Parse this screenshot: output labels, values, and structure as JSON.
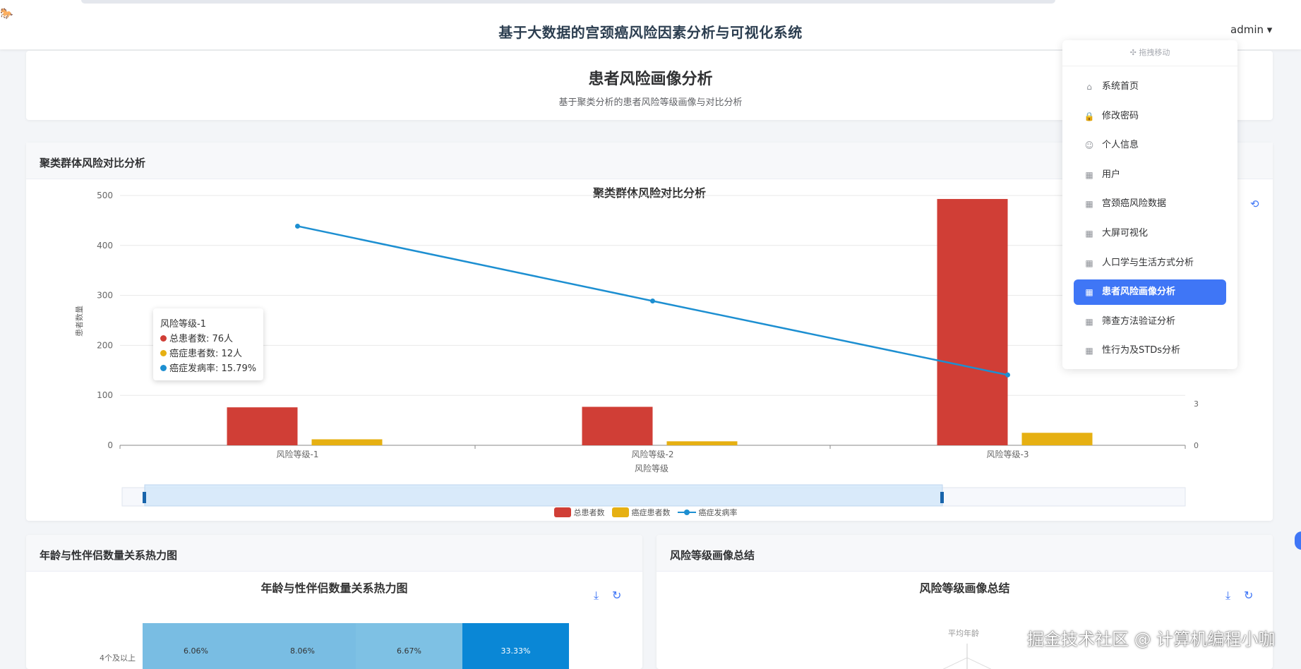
{
  "app": {
    "corner_glyph": "🐎",
    "title": "基于大数据的宫颈癌风险因素分析与可视化系统",
    "user": "admin ▾"
  },
  "page": {
    "title": "患者风险画像分析",
    "subtitle": "基于聚类分析的患者风险等级画像与对比分析"
  },
  "menu": {
    "drag_label": "✣ 拖拽移动",
    "items": [
      {
        "label": "系统首页",
        "icon": "home-icon",
        "glyph": "⌂",
        "active": false
      },
      {
        "label": "修改密码",
        "icon": "lock-icon",
        "glyph": "🔒",
        "active": false
      },
      {
        "label": "个人信息",
        "icon": "user-icon",
        "glyph": "☺",
        "active": false
      },
      {
        "label": "用户",
        "icon": "grid-icon",
        "glyph": "▦",
        "active": false
      },
      {
        "label": "宫颈癌风险数据",
        "icon": "grid-icon",
        "glyph": "▦",
        "active": false
      },
      {
        "label": "大屏可视化",
        "icon": "grid-icon",
        "glyph": "▦",
        "active": false
      },
      {
        "label": "人口学与生活方式分析",
        "icon": "grid-icon",
        "glyph": "▦",
        "active": false
      },
      {
        "label": "患者风险画像分析",
        "icon": "grid-icon",
        "glyph": "▦",
        "active": true
      },
      {
        "label": "筛查方法验证分析",
        "icon": "grid-icon",
        "glyph": "▦",
        "active": false
      },
      {
        "label": "性行为及STDs分析",
        "icon": "grid-icon",
        "glyph": "▦",
        "active": false
      }
    ]
  },
  "panels": {
    "cluster": "聚类群体风险对比分析",
    "heatmap": "年龄与性伴侣数量关系热力图",
    "summary": "风险等级画像总结"
  },
  "chart_data": [
    {
      "type": "bar",
      "title": "聚类群体风险对比分析",
      "xlabel": "风险等级",
      "ylabel": "患者数量",
      "categories": [
        "风险等级-1",
        "风险等级-2",
        "风险等级-3"
      ],
      "ylim": [
        0,
        500
      ],
      "yticks": [
        0,
        100,
        200,
        300,
        400,
        500
      ],
      "y2_ticks_visible": [
        0,
        3
      ],
      "series": [
        {
          "name": "总患者数",
          "type": "bar",
          "color": "#d03e36",
          "values": [
            76,
            77,
            493
          ]
        },
        {
          "name": "癌症患者数",
          "type": "bar",
          "color": "#e6b012",
          "values": [
            12,
            8,
            25
          ]
        },
        {
          "name": "癌症发病率",
          "type": "line",
          "color": "#1d8fd1",
          "values": [
            15.79,
            10.4,
            5.07
          ]
        }
      ],
      "y2lim": [
        0,
        18
      ],
      "legend": "bottom-center",
      "grid": true,
      "tooltip": {
        "title": "风险等级-1",
        "rows": [
          {
            "color": "#d03e36",
            "text": "总患者数: 76人"
          },
          {
            "color": "#e6b012",
            "text": "癌症患者数: 12人"
          },
          {
            "color": "#1d8fd1",
            "text": "癌症发病率: 15.79%"
          }
        ]
      }
    },
    {
      "type": "heatmap",
      "title": "年龄与性伴侣数量关系热力图",
      "y_categories": [
        "4个及以上"
      ],
      "values": [
        [
          "6.06%",
          "8.06%",
          "6.67%",
          "33.33%"
        ]
      ],
      "colors": [
        "#79bde3",
        "#79bde3",
        "#7ec1e4",
        "#0a87d6"
      ]
    },
    {
      "type": "radar",
      "title": "风险等级画像总结",
      "indicators_visible": [
        "平均年龄"
      ]
    }
  ],
  "watermark": "掘金技术社区 @ 计算机编程小咖"
}
